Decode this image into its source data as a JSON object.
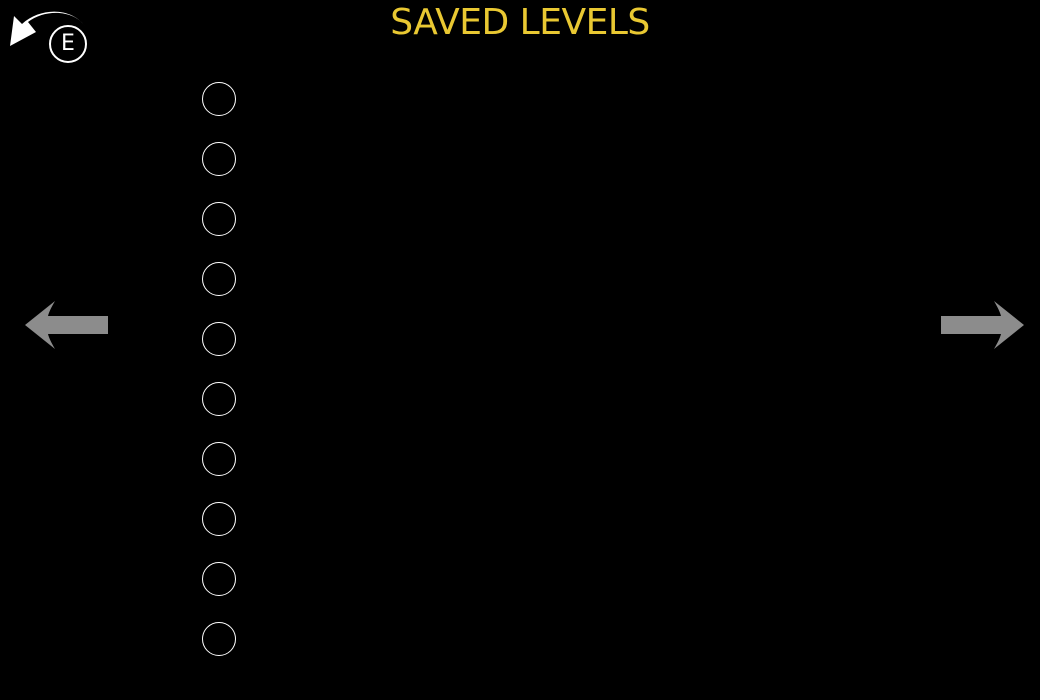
{
  "title": "SAVED LEVELS",
  "colors": {
    "title": "#e9c832",
    "background": "#000000",
    "arrow": "#8c8c8c",
    "slot_outline": "#ffffff"
  },
  "back_button": {
    "icon": "undo-arrow-icon",
    "key_hint": "E"
  },
  "navigation": {
    "prev_icon": "left-arrow-icon",
    "next_icon": "right-arrow-icon"
  },
  "slots": [
    {
      "label": "",
      "selected": false
    },
    {
      "label": "",
      "selected": false
    },
    {
      "label": "",
      "selected": false
    },
    {
      "label": "",
      "selected": false
    },
    {
      "label": "",
      "selected": false
    },
    {
      "label": "",
      "selected": false
    },
    {
      "label": "",
      "selected": false
    },
    {
      "label": "",
      "selected": false
    },
    {
      "label": "",
      "selected": false
    },
    {
      "label": "",
      "selected": false
    }
  ]
}
